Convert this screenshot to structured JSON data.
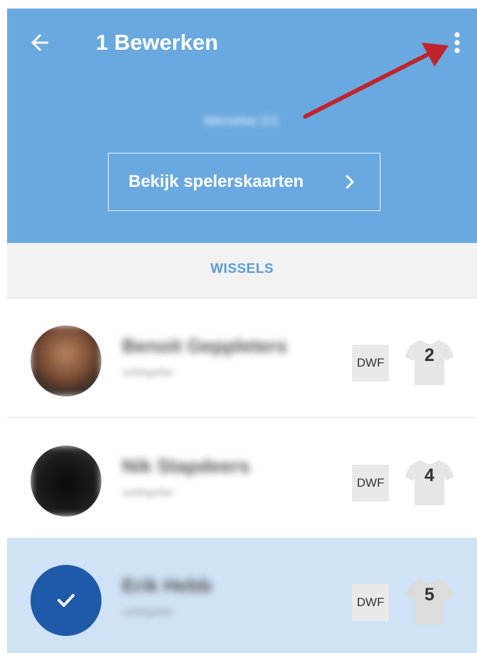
{
  "header": {
    "title": "1 Bewerken",
    "subtitle": "Wervelse 2/1",
    "cards_button_label": "Bekijk spelerskaarten",
    "background_color": "#6aa9df",
    "annotation_arrow_color": "#c0252c"
  },
  "section": {
    "title": "WISSELS"
  },
  "players": [
    {
      "name": "Benoit Geppleters",
      "role": "veldspeler",
      "position": "DWF",
      "number": "2",
      "selected": false
    },
    {
      "name": "Nik Stapdeers",
      "role": "veldspeler",
      "position": "DWF",
      "number": "4",
      "selected": false
    },
    {
      "name": "Erik Hebb",
      "role": "veldspeler",
      "position": "DWF",
      "number": "5",
      "selected": true
    }
  ],
  "icons": {
    "back": "arrow-left-icon",
    "menu": "more-vertical-icon",
    "chevron": "chevron-right-icon",
    "check": "check-icon",
    "shirt": "shirt-icon"
  },
  "colors": {
    "accent": "#5b9bd6",
    "selected_row": "#cfe2f6",
    "check_avatar": "#1f5aa8"
  }
}
